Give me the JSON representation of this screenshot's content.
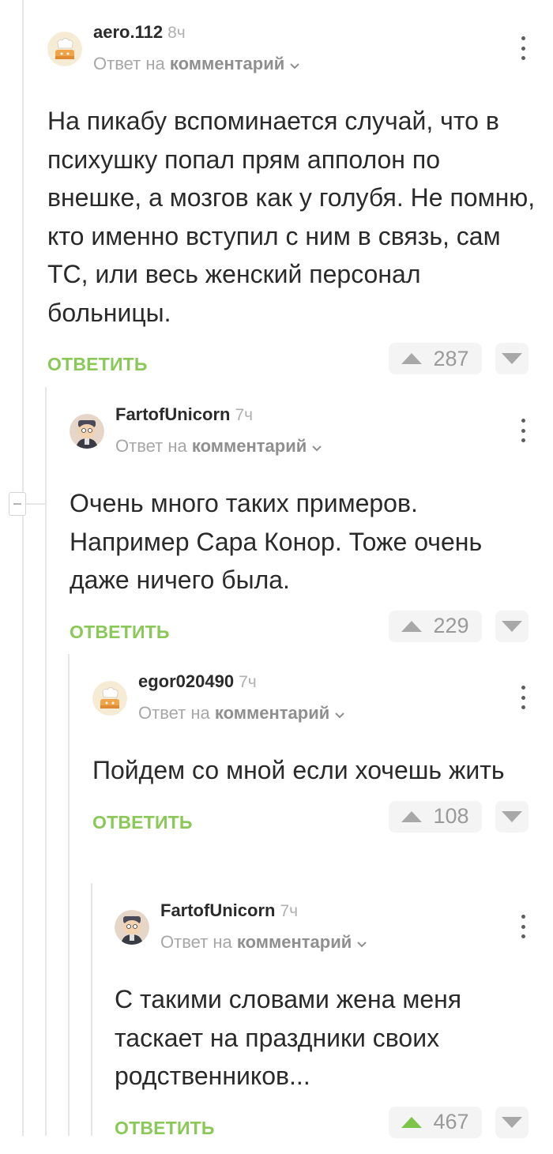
{
  "comments": [
    {
      "username": "aero.112",
      "time": "8ч",
      "reply_prefix": "Ответ на",
      "reply_target": "комментарий",
      "text": "На пикабу вспоминается случай, что в психушку попал прям апполон по внешке, а мозгов как у голубя. Не помню, кто именно вступил с ним в связь, сам ТС, или весь женский персонал больницы.",
      "reply_label": "ОТВЕТИТЬ",
      "rating": "287",
      "avatar": "chef-avatar",
      "upvoted": false
    },
    {
      "username": "FartofUnicorn",
      "time": "7ч",
      "reply_prefix": "Ответ на",
      "reply_target": "комментарий",
      "text": "Очень много таких примеров. Например Сара Конор. Тоже очень даже ничего была.",
      "reply_label": "ОТВЕТИТЬ",
      "rating": "229",
      "avatar": "cartoon-avatar",
      "upvoted": false
    },
    {
      "username": "egor020490",
      "time": "7ч",
      "reply_prefix": "Ответ на",
      "reply_target": "комментарий",
      "text": "Пойдем со мной если хочешь жить",
      "reply_label": "ОТВЕТИТЬ",
      "rating": "108",
      "avatar": "chef-avatar",
      "upvoted": false
    },
    {
      "username": "FartofUnicorn",
      "time": "7ч",
      "reply_prefix": "Ответ на",
      "reply_target": "комментарий",
      "text": "С такими словами жена меня таскает на праздники своих родственников...",
      "reply_label": "ОТВЕТИТЬ",
      "rating": "467",
      "avatar": "cartoon-avatar",
      "upvoted": true
    }
  ],
  "colors": {
    "accent_green": "#8ac858",
    "upvote_active": "#7cc548",
    "muted": "#a7a7a7",
    "text": "#2a2a2a"
  }
}
